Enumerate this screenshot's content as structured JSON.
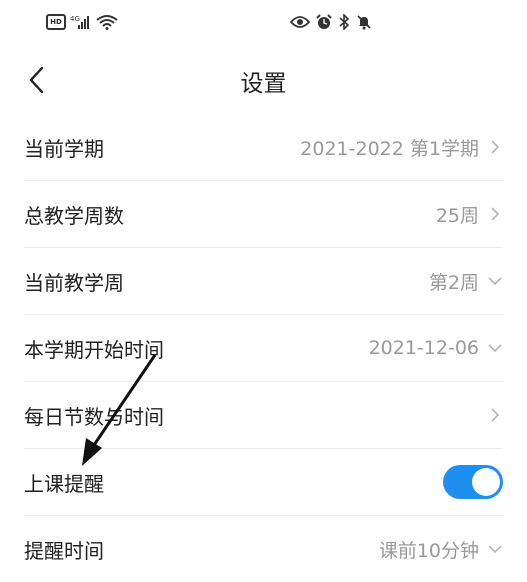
{
  "status_bar": {
    "left_icons": [
      "hd-badge-icon",
      "signal-icon",
      "wifi-icon"
    ],
    "hd_label": "HD",
    "center_icons": [
      "eye-icon",
      "alarm-icon",
      "bluetooth-icon",
      "mute-icon"
    ]
  },
  "header": {
    "title": "设置",
    "back_icon": "chevron-left-icon"
  },
  "settings": {
    "current_term": {
      "label": "当前学期",
      "value": "2021-2022 第1学期",
      "chevron": "chevron-right-icon"
    },
    "total_weeks": {
      "label": "总教学周数",
      "value": "25周",
      "chevron": "chevron-right-icon"
    },
    "current_week": {
      "label": "当前教学周",
      "value": "第2周",
      "chevron": "chevron-down-icon"
    },
    "term_start": {
      "label": "本学期开始时间",
      "value": "2021-12-06",
      "chevron": "chevron-down-icon"
    },
    "daily_periods": {
      "label": "每日节数与时间",
      "value": "",
      "chevron": "chevron-right-icon"
    },
    "class_reminder": {
      "label": "上课提醒",
      "enabled": true,
      "toggle_color": "#1e8ef0"
    },
    "reminder_time": {
      "label": "提醒时间",
      "value": "课前10分钟",
      "chevron": "chevron-down-icon"
    }
  },
  "colors": {
    "accent": "#1e8ef0",
    "label_text": "#222222",
    "value_text": "#9a9a9a",
    "divider": "#ececec"
  },
  "annotation": {
    "arrow_icon": "annotation-arrow-icon"
  }
}
